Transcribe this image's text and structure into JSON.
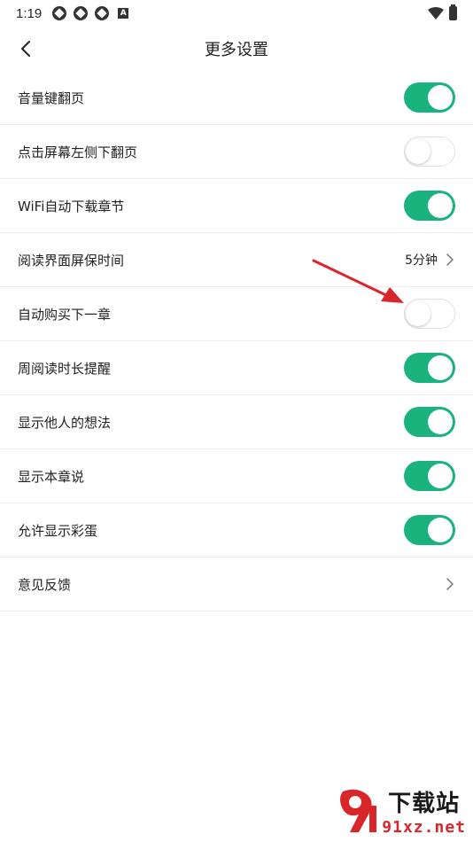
{
  "status_bar": {
    "time": "1:19",
    "icons": [
      "app-notification-icon",
      "app-notification-icon",
      "app-notification-icon",
      "a-icon",
      "wifi-icon",
      "battery-charging-icon"
    ]
  },
  "header": {
    "back_icon": "chevron-left-icon",
    "title": "更多设置"
  },
  "settings": [
    {
      "label": "音量键翻页",
      "control": "toggle",
      "state": "on"
    },
    {
      "label": "点击屏幕左侧下翻页",
      "control": "toggle",
      "state": "off"
    },
    {
      "label": "WiFi自动下载章节",
      "control": "toggle",
      "state": "on"
    },
    {
      "label": "阅读界面屏保时间",
      "control": "value",
      "value": "5分钟"
    },
    {
      "label": "自动购买下一章",
      "control": "toggle",
      "state": "off"
    },
    {
      "label": "周阅读时长提醒",
      "control": "toggle",
      "state": "on"
    },
    {
      "label": "显示他人的想法",
      "control": "toggle",
      "state": "on"
    },
    {
      "label": "显示本章说",
      "control": "toggle",
      "state": "on"
    },
    {
      "label": "允许显示彩蛋",
      "control": "toggle",
      "state": "on"
    },
    {
      "label": "意见反馈",
      "control": "link"
    }
  ],
  "colors": {
    "toggle_on": "#1bb37d",
    "toggle_off_border": "#e2e2e2",
    "annotation_arrow": "#d9262b"
  },
  "watermark": {
    "title": "下载站",
    "url": "91xz.net"
  }
}
